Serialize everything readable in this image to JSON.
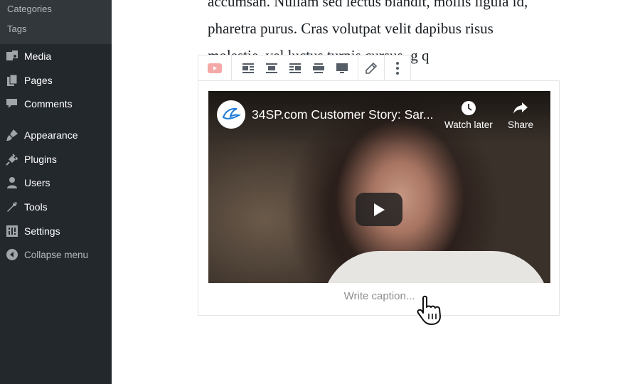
{
  "sidebar": {
    "submenu": [
      "Categories",
      "Tags"
    ],
    "items": [
      {
        "label": "Media",
        "icon": "media-icon"
      },
      {
        "label": "Pages",
        "icon": "pages-icon"
      },
      {
        "label": "Comments",
        "icon": "comments-icon"
      },
      {
        "label": "Appearance",
        "icon": "appearance-icon"
      },
      {
        "label": "Plugins",
        "icon": "plugins-icon"
      },
      {
        "label": "Users",
        "icon": "users-icon"
      },
      {
        "label": "Tools",
        "icon": "tools-icon"
      },
      {
        "label": "Settings",
        "icon": "settings-icon"
      },
      {
        "label": "Collapse menu",
        "icon": "collapse-icon"
      }
    ]
  },
  "editor": {
    "paragraph_lines": [
      "accumsan. Nullam sed lectus blandit, mollis ligula id,",
      "pharetra purus. Cras volutpat velit dapibus risus",
      "molestie, vel luctus turpis cursus.  g q"
    ]
  },
  "toolbar": {
    "buttons": [
      "youtube-block-icon",
      "align-left-icon",
      "align-center-icon",
      "align-right-icon",
      "wide-width-icon",
      "full-width-icon",
      "edit-pencil-icon",
      "more-options-icon"
    ]
  },
  "embed": {
    "video_title": "34SP.com Customer Story: Sar...",
    "watch_later": "Watch later",
    "share": "Share",
    "caption_placeholder": "Write caption..."
  },
  "colors": {
    "sidebar_bg": "#23282d",
    "submenu_bg": "#32373c",
    "youtube_red": "#ff0000",
    "text_dark": "#191e23"
  }
}
